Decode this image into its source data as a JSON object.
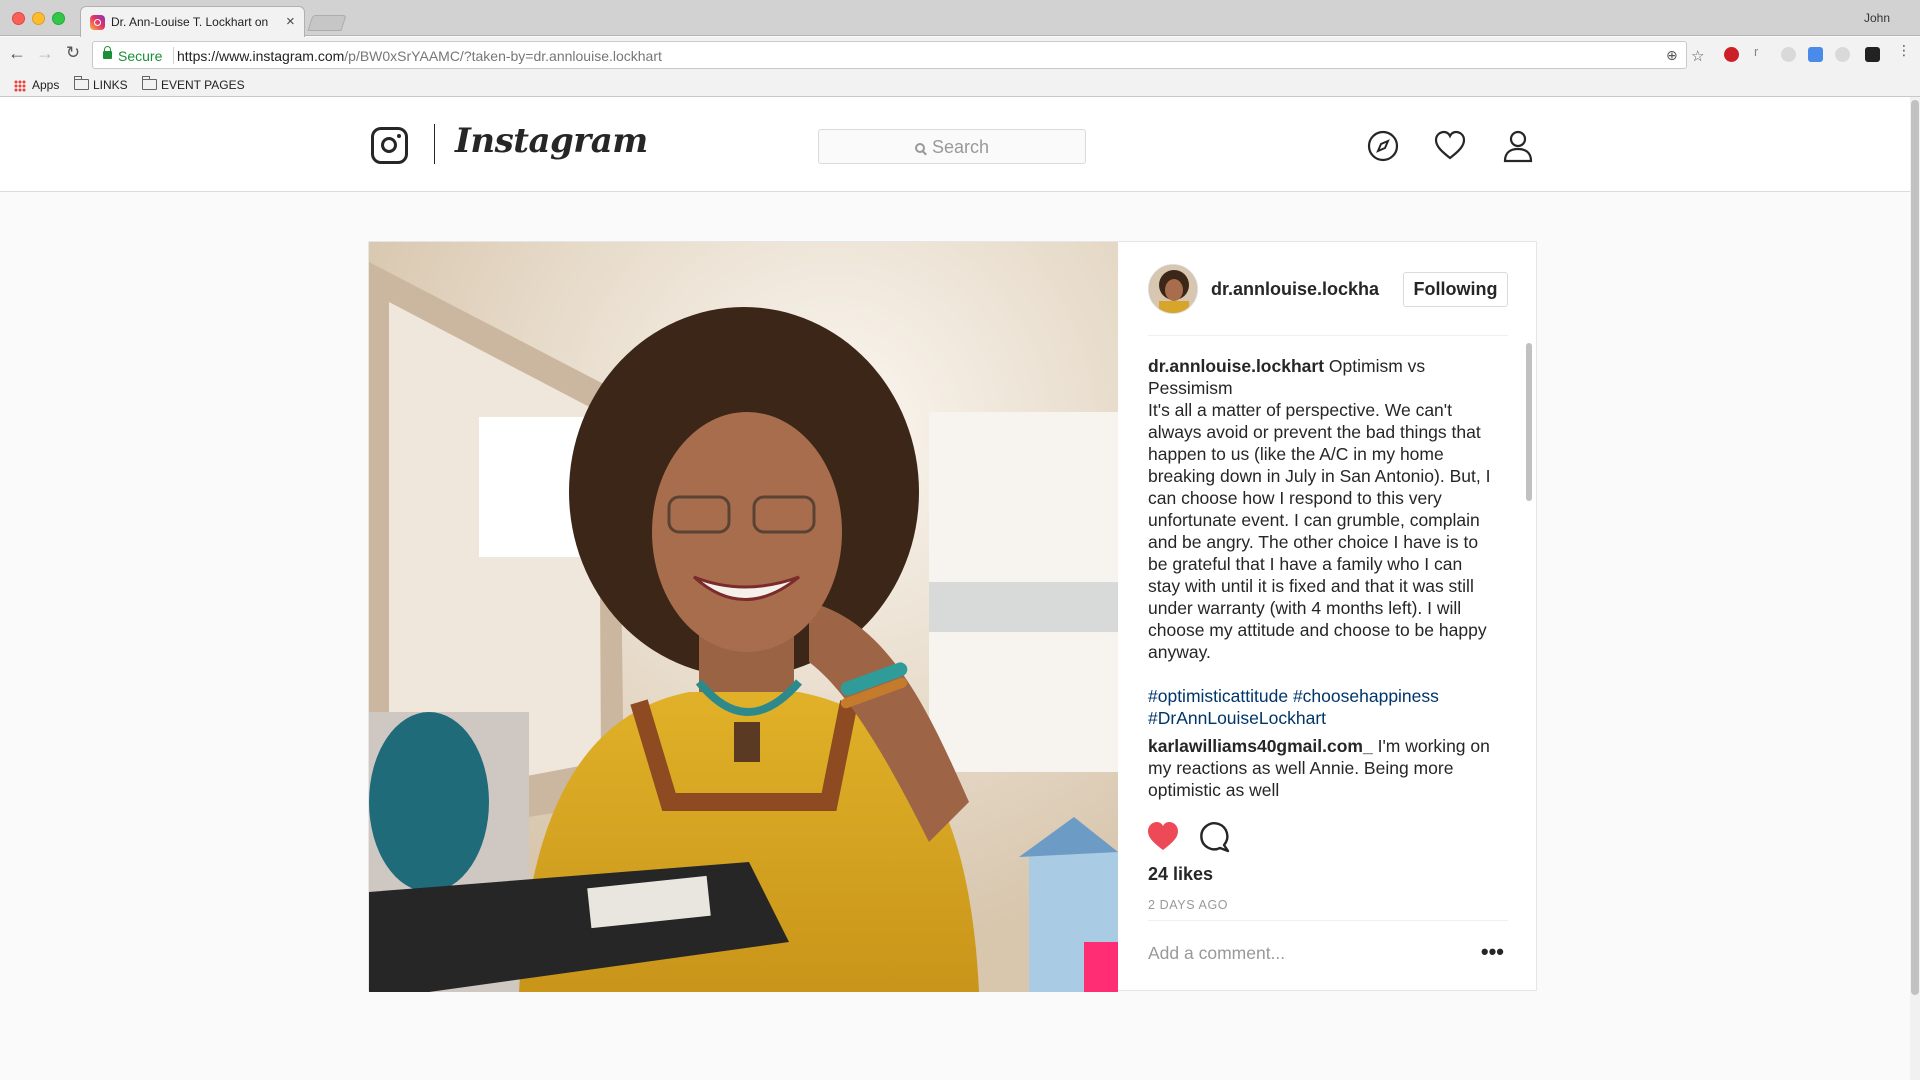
{
  "browser": {
    "tab_title": "Dr. Ann-Louise T. Lockhart on",
    "profile_name": "John",
    "secure_label": "Secure",
    "url_host": "https://www.instagram.com",
    "url_path": "/p/BW0xSrYAAMC/?taken-by=dr.annlouise.lockhart",
    "bookmarks": [
      "Apps",
      "LINKS",
      "EVENT PAGES"
    ]
  },
  "header": {
    "wordmark": "Instagram",
    "search_placeholder": "Search"
  },
  "post": {
    "username": "dr.annlouise.lockha",
    "follow_label": "Following",
    "caption_user": "dr.annlouise.lockhart",
    "caption_text": "Optimism vs Pessimism",
    "caption_body": "It's all a matter of perspective. We can't always avoid or prevent the bad things that happen to us (like the A/C in my home breaking down in July in San Antonio). But, I can choose how I respond to this very unfortunate event. I can grumble, complain and be angry. The other choice I have is to be grateful that I have a family who I can stay with until it is fixed and that it was still under warranty (with 4 months left). I will choose my attitude and choose to be happy anyway.",
    "hashtags": [
      "#optimisticattitude",
      "#choosehappiness",
      "#DrAnnLouiseLockhart"
    ],
    "comment_user": "karlawilliams40gmail.com_",
    "comment_text": "I'm working on my reactions as well Annie. Being more optimistic as well",
    "likes": "24 likes",
    "timestamp": "2 DAYS AGO",
    "add_comment_placeholder": "Add a comment...",
    "more_label": "•••",
    "liked": true
  },
  "colors": {
    "like_red": "#ed4956",
    "hashtag": "#003569",
    "secure_green": "#1a8f38"
  },
  "icons": [
    "instagram-logo-icon",
    "search-icon",
    "compass-icon",
    "heart-icon",
    "profile-icon",
    "comment-icon",
    "lock-icon"
  ]
}
